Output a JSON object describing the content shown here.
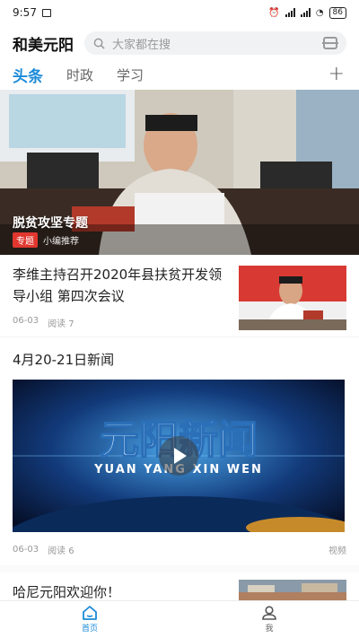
{
  "status": {
    "time": "9:57",
    "battery": "86"
  },
  "header": {
    "app_title": "和美元阳",
    "search_placeholder": "大家都在搜"
  },
  "tabs": [
    {
      "label": "头条"
    },
    {
      "label": "时政"
    },
    {
      "label": "学习"
    }
  ],
  "banner": {
    "title": "脱贫攻坚专题",
    "tag": "专题",
    "recommend": "小编推荐"
  },
  "news": [
    {
      "title": "李维主持召开2020年县扶贫开发领导小组 第四次会议",
      "date": "06-03",
      "reads": "阅读 7"
    }
  ],
  "video": {
    "section_title": "4月20-21日新闻",
    "cover_text": "元阳新闻",
    "cover_pinyin": "YUAN YANG XIN WEN",
    "date": "06-03",
    "reads": "阅读 6",
    "type_label": "视频"
  },
  "partial_item": {
    "title": "哈尼元阳欢迎你！"
  },
  "bottom_nav": [
    {
      "label": "首页"
    },
    {
      "label": "我"
    }
  ],
  "colors": {
    "accent": "#1a8ad8",
    "tag_red": "#e1372f"
  }
}
